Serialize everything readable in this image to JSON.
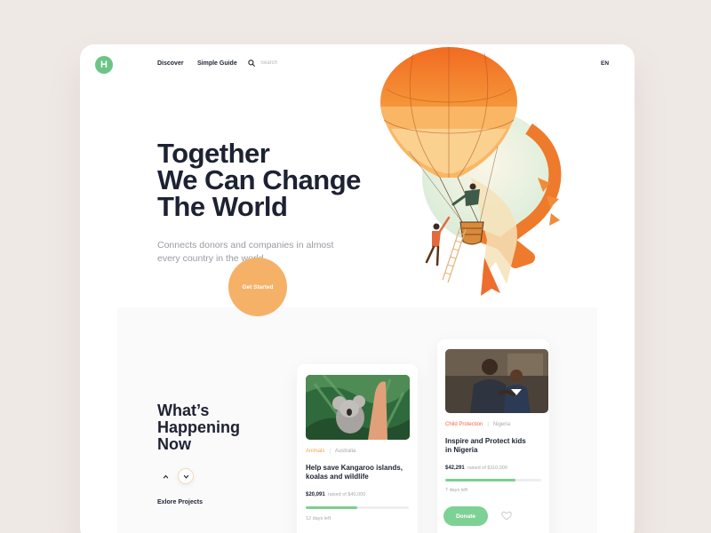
{
  "logo": {
    "letter": "H"
  },
  "nav": {
    "discover": "Discover",
    "guide": "Simple Guide",
    "search_placeholder": "Search",
    "lang": "EN"
  },
  "hero": {
    "title_lines": [
      "Together",
      "We Can Change",
      "The World"
    ],
    "subtitle": "Connects donors and companies in almost every country in the world",
    "cta": "Get Started"
  },
  "section": {
    "title_lines": [
      "What’s",
      "Happening",
      "Now"
    ],
    "explore": "Exlore Projects"
  },
  "cards": [
    {
      "category": "Animals",
      "location": "Australia",
      "title": "Help save Kangaroo islands, koalas and wildlife",
      "raised": "$20,091",
      "goal_text": "raised of $40,000",
      "progress": 0.5,
      "days": "12 days left"
    },
    {
      "category": "Child Protection",
      "location": "Nigeria",
      "title": "Inspire and Protect kids in Nigeria",
      "raised": "$42,291",
      "goal_text": "raised of $110,000",
      "progress": 0.73,
      "days": "7 days left",
      "donate": "Donate"
    }
  ],
  "colors": {
    "brand_green": "#6cc587",
    "accent_orange": "#f5b168",
    "animals_tag": "#f3a54d",
    "child_tag": "#f2664b"
  },
  "icons": [
    "search-icon",
    "chevron-up-icon",
    "chevron-down-icon",
    "heart-icon",
    "balloon-illustration",
    "koala-photo",
    "kids-photo"
  ]
}
